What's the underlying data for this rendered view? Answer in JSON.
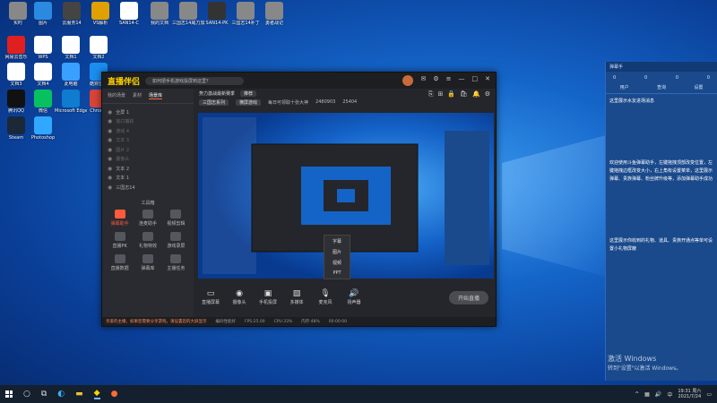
{
  "desktop_icons": [
    {
      "label": "实时",
      "color": "#888"
    },
    {
      "label": "图片",
      "color": "#2a8ae0"
    },
    {
      "label": "云服务14",
      "color": "#444"
    },
    {
      "label": "VS解析",
      "color": "#e0a000"
    },
    {
      "label": "SAN14-C",
      "color": "#fff"
    },
    {
      "label": "我的文档",
      "color": "#888"
    },
    {
      "label": "三国志14威力加强版",
      "color": "#888"
    },
    {
      "label": "SAN14-PK",
      "color": "#333"
    },
    {
      "label": "三国志14补丁",
      "color": "#888"
    },
    {
      "label": "勇者战记",
      "color": "#888"
    },
    {
      "label": "网易云音乐",
      "color": "#e02020"
    },
    {
      "label": "WPS",
      "color": "#fff"
    },
    {
      "label": "文档1",
      "color": "#fff"
    },
    {
      "label": "文档2",
      "color": "#fff"
    },
    {
      "label": "文档3",
      "color": "#fff"
    },
    {
      "label": "文档4",
      "color": "#fff"
    },
    {
      "label": "此电脑",
      "color": "#3aa0ff"
    },
    {
      "label": "酷狗音乐",
      "color": "#1b8ef0"
    },
    {
      "label": "腾讯QQ",
      "color": "#111"
    },
    {
      "label": "微信",
      "color": "#07c160"
    },
    {
      "label": "Microsoft Edge",
      "color": "#0f7cd0"
    },
    {
      "label": "Chrome",
      "color": "#db4437"
    },
    {
      "label": "Steam",
      "color": "#1b2838"
    },
    {
      "label": "Photoshop",
      "color": "#31a8ff"
    }
  ],
  "app": {
    "logo": "直播伴侣",
    "notice": "如何把手机游戏投屏到这里？",
    "topbar": {
      "title": "势力激战最新赛季",
      "tag": "推荐",
      "room": "三国志系列",
      "category": "横屏游戏",
      "hint": "每日可领取十张大神",
      "count": "2480903",
      "hot": "25404"
    },
    "left_tabs": [
      "我的场景",
      "素材",
      "场景库"
    ],
    "scenes": [
      {
        "label": "全屏 1",
        "dim": false
      },
      {
        "label": "窗口捕获",
        "dim": true
      },
      {
        "label": "游戏 4",
        "dim": true
      },
      {
        "label": "文本 3",
        "dim": true
      },
      {
        "label": "图片 2",
        "dim": true
      },
      {
        "label": "摄像头",
        "dim": true
      },
      {
        "label": "文本 2",
        "dim": false
      },
      {
        "label": "文本 1",
        "dim": false
      },
      {
        "label": "三国志14",
        "dim": false
      }
    ],
    "toolbox_label": "工具箱",
    "tools": [
      {
        "label": "弹幕助手",
        "hl": true
      },
      {
        "label": "连麦助手",
        "hl": false
      },
      {
        "label": "视频剪辑",
        "hl": false
      },
      {
        "label": "直播PK",
        "hl": false
      },
      {
        "label": "礼物特效",
        "hl": false
      },
      {
        "label": "游戏录屏",
        "hl": false
      },
      {
        "label": "直播数据",
        "hl": false
      },
      {
        "label": "弹幕库",
        "hl": false
      },
      {
        "label": "主播任务",
        "hl": false
      }
    ],
    "bottom": [
      {
        "icon": "▭",
        "label": "直播屏幕"
      },
      {
        "icon": "◉",
        "label": "摄像头"
      },
      {
        "icon": "▣",
        "label": "手机投屏"
      },
      {
        "icon": "▧",
        "label": "多媒体"
      },
      {
        "icon": "🎙",
        "label": "麦克风"
      },
      {
        "icon": "🔊",
        "label": "扬声器"
      }
    ],
    "start_live": "开始直播",
    "context_menu": [
      "字幕",
      "图片",
      "视频",
      "PPT"
    ],
    "status": {
      "warning": "亲爱的主播，如果您需要分享游戏，请设置您的大屏显示",
      "codec": "编码性能好",
      "fps": "FPS:25.00",
      "cpu": "CPU:33%",
      "mem": "内存:48%",
      "time": "00:00:00"
    }
  },
  "side_panel": {
    "title": "弹幕手",
    "stats": [
      "0",
      "0",
      "0",
      "0"
    ],
    "tabs": [
      "用户",
      "查询",
      "设置"
    ],
    "text1": "这里展示水友进场消息",
    "text2": "欢迎使用斗鱼弹幕助手，左键拖拽顶部改变位置，左键拖拽边框改变大小，右上角有设置菜单，这里展示弹幕、贵族弹幕、粉丝牌升级等，添加弹幕助手成功",
    "text3": "这里展示你收到的礼物、道具、贵族开通点等单可设置小礼物屏蔽"
  },
  "activate": {
    "title": "激活 Windows",
    "hint": "转到\"设置\"以激活 Windows。"
  },
  "taskbar": {
    "time": "19:31 周六",
    "date": "2021/7/24"
  }
}
